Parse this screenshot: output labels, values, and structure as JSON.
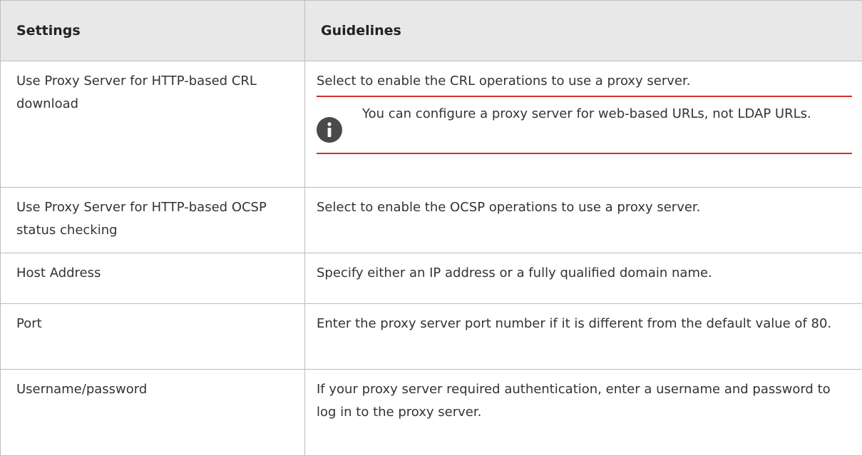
{
  "table": {
    "headers": {
      "settings": "Settings",
      "guidelines": "Guidelines"
    },
    "rows": [
      {
        "setting": "Use Proxy Server for HTTP-based CRL download",
        "guideline": "Select to enable the CRL operations to use a proxy server.",
        "note": "You can configure a proxy server for web-based URLs, not LDAP URLs."
      },
      {
        "setting": "Use Proxy Server for HTTP-based OCSP status checking",
        "guideline": "Select to enable the OCSP operations to use a proxy server."
      },
      {
        "setting": "Host Address",
        "guideline": "Specify either an IP address or a fully qualified domain name."
      },
      {
        "setting": "Port",
        "guideline": "Enter the proxy server port number if it is different from the default value of 80."
      },
      {
        "setting": "Username/password",
        "guideline": "If your proxy server required authentication, enter a username and password to log in to the proxy server."
      }
    ]
  },
  "colors": {
    "header_bg": "#e8e8e8",
    "note_rule": "#d32f2f",
    "info_icon_bg": "#4a4a4a"
  },
  "icons": {
    "note": "info-icon"
  }
}
